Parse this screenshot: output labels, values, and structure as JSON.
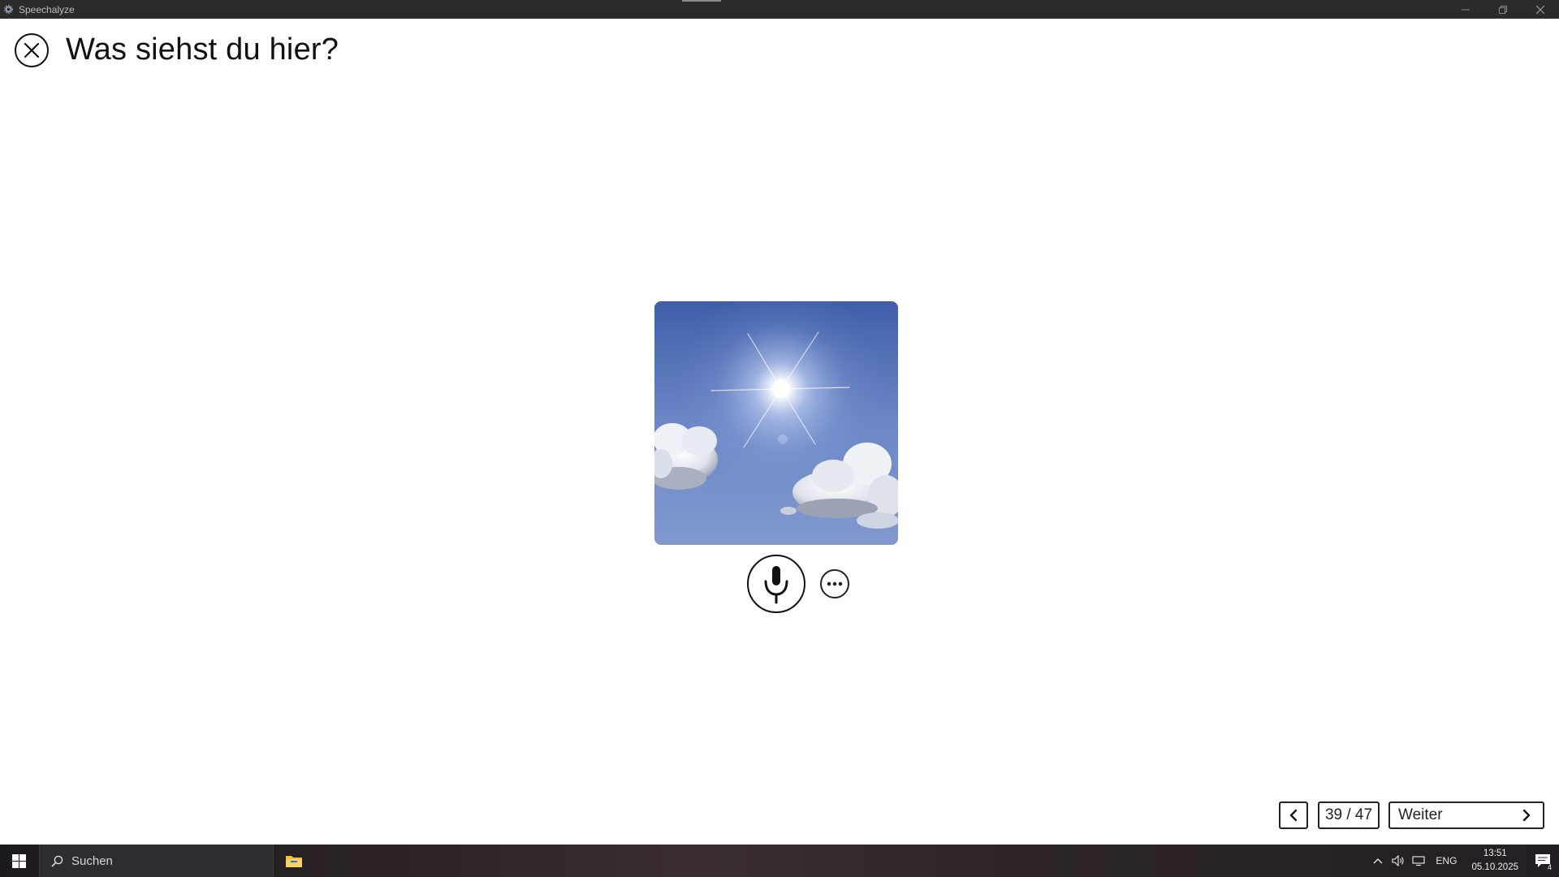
{
  "window": {
    "app_title": "Speechalyze",
    "icons": [
      "gear-icon",
      "minimize-icon",
      "restore-icon",
      "close-icon"
    ]
  },
  "header": {
    "title": "Was siehst du hier?",
    "close_icon": "close-icon"
  },
  "prompt_image": {
    "icon": "sun-sky-clouds-image"
  },
  "controls": {
    "mic_icon": "microphone-icon",
    "more_icon": "ellipsis-icon"
  },
  "navigation": {
    "prev_icon": "chevron-left-icon",
    "counter": "39 / 47",
    "current": 39,
    "total": 47,
    "next_label": "Weiter",
    "next_icon": "chevron-right-icon"
  },
  "taskbar": {
    "search_placeholder": "Suchen",
    "language": "ENG",
    "time": "13:51",
    "date": "05.10.2025",
    "notification_count": "4"
  },
  "colors": {
    "titlebar": "#2b2b2b",
    "background": "#ffffff",
    "text": "#111111",
    "sky": "#6f87c0"
  }
}
